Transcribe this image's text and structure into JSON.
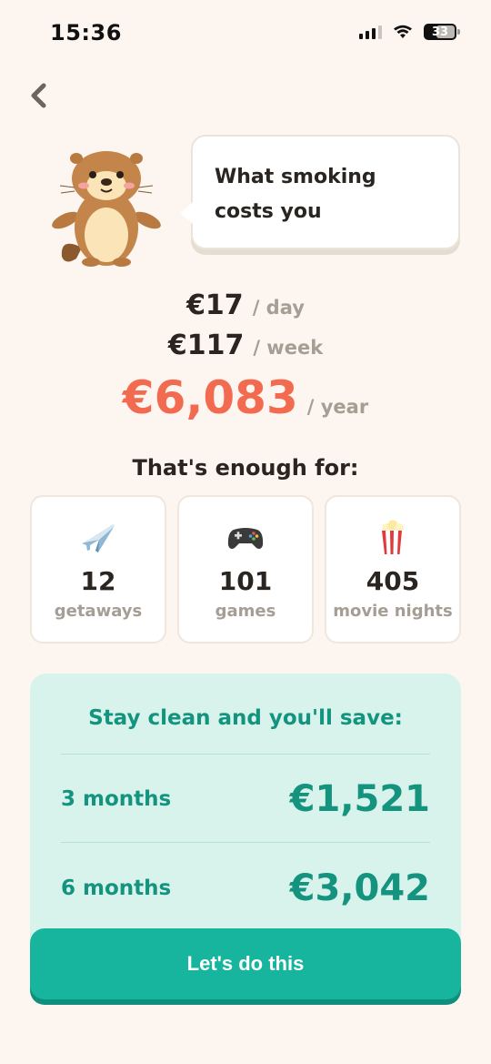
{
  "status_bar": {
    "time": "15:36",
    "battery": "33"
  },
  "bubble": {
    "text": "What smoking costs you"
  },
  "costs": {
    "day": {
      "amount": "€17",
      "period": "/ day"
    },
    "week": {
      "amount": "€117",
      "period": "/ week"
    },
    "year": {
      "amount": "€6,083",
      "period": "/ year"
    }
  },
  "enough": {
    "title": "That's enough for:",
    "items": [
      {
        "icon": "airplane-icon",
        "value": "12",
        "label": "getaways"
      },
      {
        "icon": "gamepad-icon",
        "value": "101",
        "label": "games"
      },
      {
        "icon": "popcorn-icon",
        "value": "405",
        "label": "movie nights"
      }
    ]
  },
  "savings": {
    "title": "Stay clean and you'll save:",
    "rows": [
      {
        "period": "3 months",
        "amount": "€1,521"
      },
      {
        "period": "6 months",
        "amount": "€3,042"
      }
    ]
  },
  "cta": {
    "label": "Let's do this"
  },
  "colors": {
    "accent": "#18b59e",
    "cost_highlight": "#f26a4f",
    "savings_text": "#14937e",
    "background": "#fdf5ef"
  }
}
